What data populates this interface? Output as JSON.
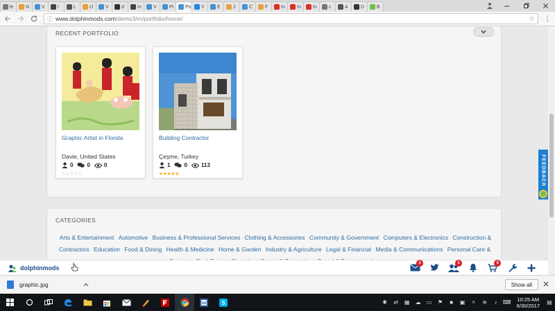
{
  "browser": {
    "tabs": [
      {
        "label": "le",
        "color": "#777777"
      },
      {
        "label": "N",
        "color": "#e8a33d"
      },
      {
        "label": "V",
        "color": "#4a90d9"
      },
      {
        "label": "I",
        "color": "#444444"
      },
      {
        "label": "L",
        "color": "#555555"
      },
      {
        "label": "cl",
        "color": "#e8a33d"
      },
      {
        "label": "V",
        "color": "#4a90d9"
      },
      {
        "label": "d",
        "color": "#333333"
      },
      {
        "label": "m",
        "color": "#444444"
      },
      {
        "label": "V",
        "color": "#4a90d9"
      },
      {
        "label": "Pi",
        "color": "#4a90d9"
      },
      {
        "label": "Po",
        "color": "#4a90d9"
      },
      {
        "label": "V",
        "color": "#1e88e5"
      },
      {
        "label": "E",
        "color": "#4a90d9"
      },
      {
        "label": "2",
        "color": "#e8a33d"
      },
      {
        "label": "C",
        "color": "#4a90d9"
      },
      {
        "label": "F",
        "color": "#e8a33d"
      },
      {
        "label": "In",
        "color": "#d93025"
      },
      {
        "label": "In",
        "color": "#d93025"
      },
      {
        "label": "In",
        "color": "#d93025"
      },
      {
        "label": "c",
        "color": "#777777"
      },
      {
        "label": "A",
        "color": "#555555"
      },
      {
        "label": "D",
        "color": "#333333"
      },
      {
        "label": "B",
        "color": "#6cc04a"
      }
    ],
    "active_tab_index": 11,
    "url_host": "www.dolphinmods.com",
    "url_path": "/demo3/m/portfolio/home/"
  },
  "portfolio": {
    "section_title": "RECENT PORTFOLIO",
    "items": [
      {
        "title": "Graphic Artist in Florida",
        "location": "Davie, United States",
        "members": "0",
        "comments": "0",
        "views": "0",
        "rating": 0,
        "star_color": "#cccccc"
      },
      {
        "title": "Building Contractor",
        "location": "Çeşme, Turkey",
        "members": "1",
        "comments": "0",
        "views": "113",
        "rating": 5,
        "star_color": "#f2b01e"
      }
    ]
  },
  "categories": {
    "section_title": "CATEGORIES",
    "items": [
      "Arts & Entertainment",
      "Automotive",
      "Business & Professional Services",
      "Clothing & Accessories",
      "Community & Government",
      "Computers & Electronics",
      "Construction & Contractors",
      "Education",
      "Food & Dining",
      "Health & Medicine",
      "Home & Garden",
      "Industry & Agriculture",
      "Legal & Financial",
      "Media & Communications",
      "Personal Care & Services",
      "Real Estate",
      "Shopping",
      "Sports & Recreation",
      "Travel & Transportation"
    ]
  },
  "site_toolbar": {
    "brand": "dolphinmods",
    "mail_badge": "1",
    "friends_badge": "1",
    "cart_badge": "3",
    "accent": "#1e4f8a"
  },
  "feedback": {
    "label": "FEEDBACK"
  },
  "downloads": {
    "file_name": "graphic.jpg",
    "show_all_label": "Show all"
  },
  "taskbar": {
    "time": "10:25 AM",
    "date": "6/30/2017"
  }
}
